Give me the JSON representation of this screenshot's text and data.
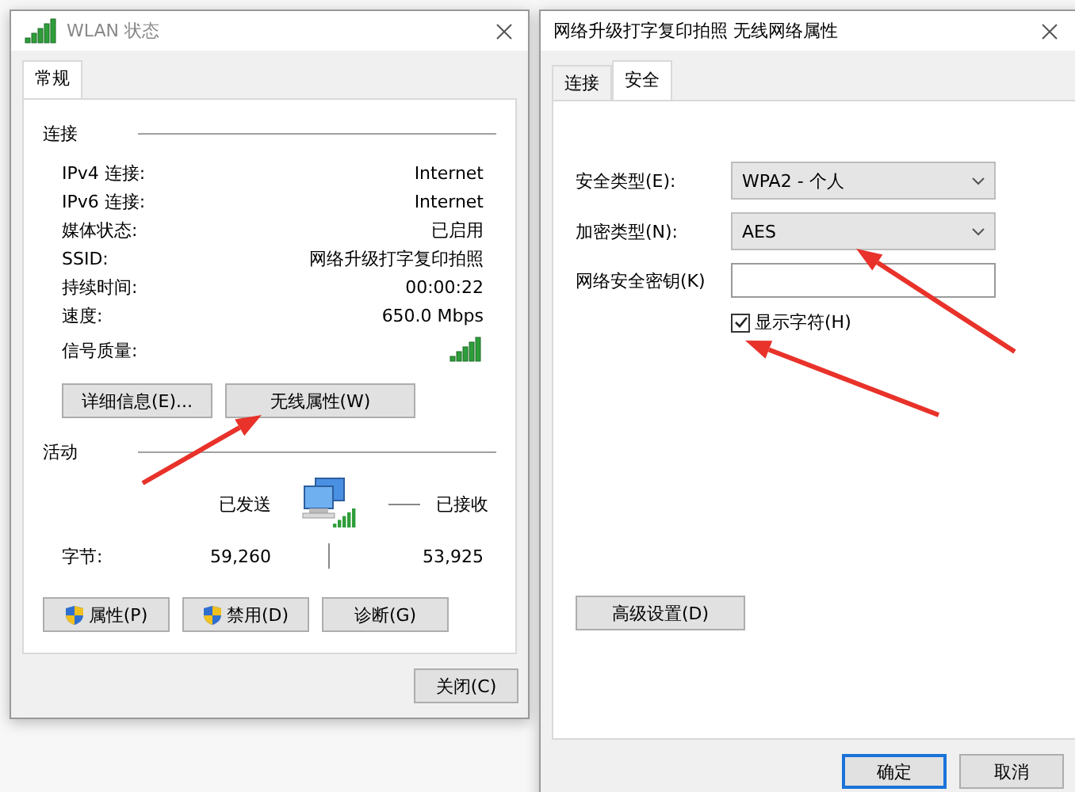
{
  "status_window": {
    "title": "WLAN 状态",
    "tabs": [
      {
        "label": "常规",
        "selected": true
      }
    ],
    "connection": {
      "heading": "连接",
      "rows": [
        {
          "label": "IPv4 连接:",
          "value": "Internet",
          "kind": "text"
        },
        {
          "label": "IPv6 连接:",
          "value": "Internet",
          "kind": "text"
        },
        {
          "label": "媒体状态:",
          "value": "已启用",
          "kind": "text"
        },
        {
          "label": "SSID:",
          "value": "网络升级打字复印拍照",
          "kind": "text"
        },
        {
          "label": "持续时间:",
          "value": "00:00:22",
          "kind": "text"
        },
        {
          "label": "速度:",
          "value": "650.0 Mbps",
          "kind": "text"
        },
        {
          "label": "信号质量:",
          "kind": "signal"
        }
      ],
      "buttons": [
        "详细信息(E)...",
        "无线属性(W)"
      ]
    },
    "activity": {
      "heading": "活动",
      "sent_label": "已发送",
      "received_label": "已接收",
      "bytes_label": "字节:",
      "bytes_sent": "59,260",
      "bytes_received": "53,925"
    },
    "buttons": [
      {
        "label": "属性(P)",
        "shield": true
      },
      {
        "label": "禁用(D)",
        "shield": true
      },
      {
        "label": "诊断(G)",
        "shield": false
      }
    ],
    "footer_buttons": [
      {
        "label": "关闭(C)",
        "default": false
      }
    ]
  },
  "properties_window": {
    "title": "网络升级打字复印拍照 无线网络属性",
    "tabs": [
      {
        "label": "连接",
        "selected": false
      },
      {
        "label": "安全",
        "selected": true
      }
    ],
    "fields": [
      {
        "label": "安全类型(E):",
        "kind": "select",
        "value": "WPA2 - 个人"
      },
      {
        "label": "加密类型(N):",
        "kind": "select",
        "value": "AES"
      },
      {
        "label": "网络安全密钥(K)",
        "kind": "input"
      }
    ],
    "show_characters": {
      "label": "显示字符(H)",
      "checked": true
    },
    "advanced_button": "高级设置(D)",
    "footer_buttons": [
      {
        "label": "确定",
        "default": true
      },
      {
        "label": "取消",
        "default": false
      }
    ]
  }
}
